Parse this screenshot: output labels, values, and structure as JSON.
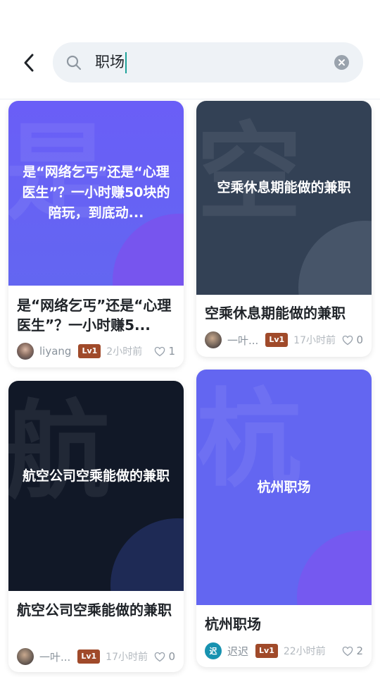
{
  "search": {
    "query": "职场"
  },
  "cards": [
    {
      "cover_char": "是",
      "cover_text": "是“网络乞丐”还是“心理医生”？一小时赚50块的陪玩，到底动...",
      "title": "是“网络乞丐”还是“心理医生”？一小时赚5...",
      "author": "liyang",
      "level": "Lv1",
      "time": "2小时前",
      "likes": "1"
    },
    {
      "cover_char": "空",
      "cover_text": "空乘休息期能做的兼职",
      "title": "空乘休息期能做的兼职",
      "author": "一叶...",
      "level": "Lv1",
      "time": "17小时前",
      "likes": "0"
    },
    {
      "cover_char": "航",
      "cover_text": "航空公司空乘能做的兼职",
      "title": "航空公司空乘能做的兼职",
      "author": "一叶...",
      "level": "Lv1",
      "time": "17小时前",
      "likes": "0"
    },
    {
      "cover_char": "杭",
      "cover_text": "杭州职场",
      "title": "杭州职场",
      "author": "迟迟",
      "avatar_char": "迟",
      "level": "Lv1",
      "time": "22小时前",
      "likes": "2"
    }
  ],
  "colors": {
    "purple_cover": "#6366f1",
    "slate_cover": "#334155",
    "navy_cover": "#111827",
    "level_badge": "#a04a2a",
    "caret": "#1fa39a"
  }
}
